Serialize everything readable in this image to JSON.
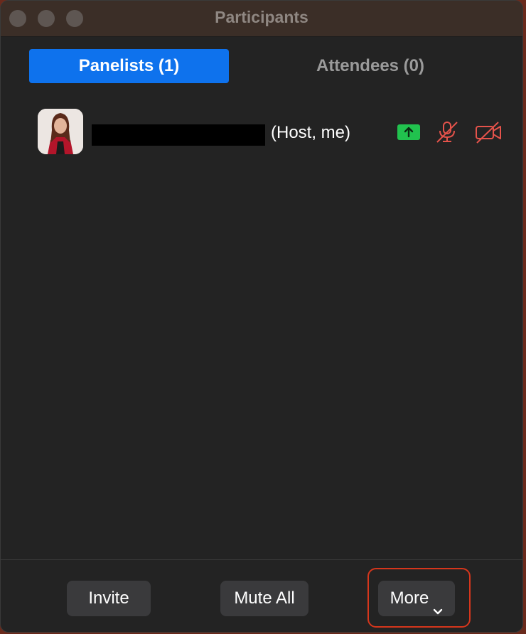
{
  "window": {
    "title": "Participants"
  },
  "tabs": [
    {
      "label": "Panelists (1)",
      "active": true
    },
    {
      "label": "Attendees (0)",
      "active": false
    }
  ],
  "participants": [
    {
      "name_suffix": "(Host, me)",
      "name_redacted": true,
      "icons": [
        "share-screen-icon",
        "mic-muted-icon",
        "video-off-icon"
      ]
    }
  ],
  "footer": {
    "invite_label": "Invite",
    "mute_all_label": "Mute All",
    "more_label": "More"
  },
  "colors": {
    "accent": "#0e72ed",
    "share_green": "#21c24e",
    "muted_red": "#e5534b",
    "highlight": "#d6361c"
  }
}
